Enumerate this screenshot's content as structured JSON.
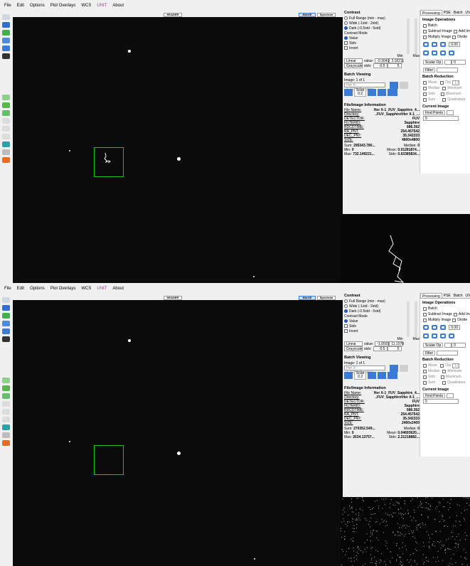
{
  "menu": [
    "File",
    "Edit",
    "Options",
    "Plot Overlays",
    "WCS",
    "UNIT",
    "About"
  ],
  "header_label": "HEADER",
  "image_btn": "IMAGE",
  "spectrum_btn": "Spectrum",
  "contrast": {
    "title": "Contrast",
    "full": "Full Range (min - max)",
    "wide": "Wide (-1std - 2std)",
    "dark": "Dark (-0.5std - 5std)",
    "mode_title": "Contrast Mode",
    "value": "Value",
    "stdv": "Stdv",
    "invert": "Invert",
    "min_label": "Min",
    "max_label": "Max",
    "scale": "Linear",
    "cmap": "Grayscale",
    "value_label": "value:",
    "stdv_label": "stdv:"
  },
  "batch": {
    "title": "Batch Viewing",
    "image": "Image: 1 of 1",
    "file_sel": "Her X-1_FUV_Sapphire",
    "scan": "Scan",
    "scan_val": "0.2"
  },
  "info": {
    "title": "File/Image Information",
    "filename_label": "File Name:",
    "directory_label": "Directory:",
    "detector_label": "DETECTOR:",
    "filter_label": "FILTERID:",
    "rdc_label": "RDCDTIME:",
    "ra_label": "RA_PNT:",
    "dec_label": "DEC_PNT:",
    "size_label": "SIZE:",
    "sum_label": "Sum:",
    "median_label": "Median:",
    "min_label": "Min:",
    "mean_label": "Mean:",
    "max_label": "Max:",
    "stdv_label": "Stdv:"
  },
  "views": [
    {
      "filename": "Her X-1_FUV_Sapphire_4...",
      "directory": "..FUV_Sapphire\\Her X-1_...",
      "detector": "FUV",
      "filter": "Sapphire",
      "rdc": "986.392",
      "ra": "254.457542",
      "dec": "35.342333",
      "size": "4800x4800",
      "sum": "295343.780...",
      "median": "0",
      "min": "0",
      "mean": "0.01281874...",
      "max": "732.149221...",
      "stdv": "0.63385834...",
      "vmin": "-0.30411",
      "vmax": "3.18211",
      "smin": "-0.5",
      "smax": "5",
      "step": "0.00"
    },
    {
      "filename": "Her X-1_FUV_Sapphire_4...",
      "directory": "..FUV_Sapphire\\Her X-1_...",
      "detector": "FUV",
      "filter": "Sapphire",
      "rdc": "986.392",
      "ra": "254.457542",
      "dec": "35.342333",
      "size": "2400x2400",
      "sum": "270352.549...",
      "median": "0",
      "min": "0",
      "mean": "0.04693620...",
      "max": "2634.13757...",
      "stdv": "2.21218882...",
      "vmin": "-1.05916",
      "vmax": "11.1078",
      "smin": "-0.5",
      "smax": "5",
      "step": "0.00"
    }
  ],
  "processing": {
    "tabs": [
      "Processing",
      "PSE",
      "Batch",
      "UV"
    ],
    "image_ops": "Image Operations",
    "batch": "Batch",
    "subtract": "Subtract Image",
    "add": "Add Im",
    "multiply": "Multiply Image",
    "divide": "Divide",
    "scalar_op": "Scalar Op",
    "scalar_val": "0",
    "filter": "Filter",
    "batch_red": "Batch Reduction",
    "mean": "Mean",
    "clip": "Clip",
    "clip_val": "1.0",
    "median": "Median",
    "minimum": "Minimum",
    "stdv": "Stdv",
    "maximum": "Maximum",
    "sum": "Sum",
    "quadrature": "Quadrature",
    "current": "Current Image",
    "find_points": "Find Points",
    "find_val": "0"
  },
  "colors": {
    "roi": "#16c616",
    "accent": "#1e56c8",
    "unit_menu": "#9b3f9a"
  }
}
